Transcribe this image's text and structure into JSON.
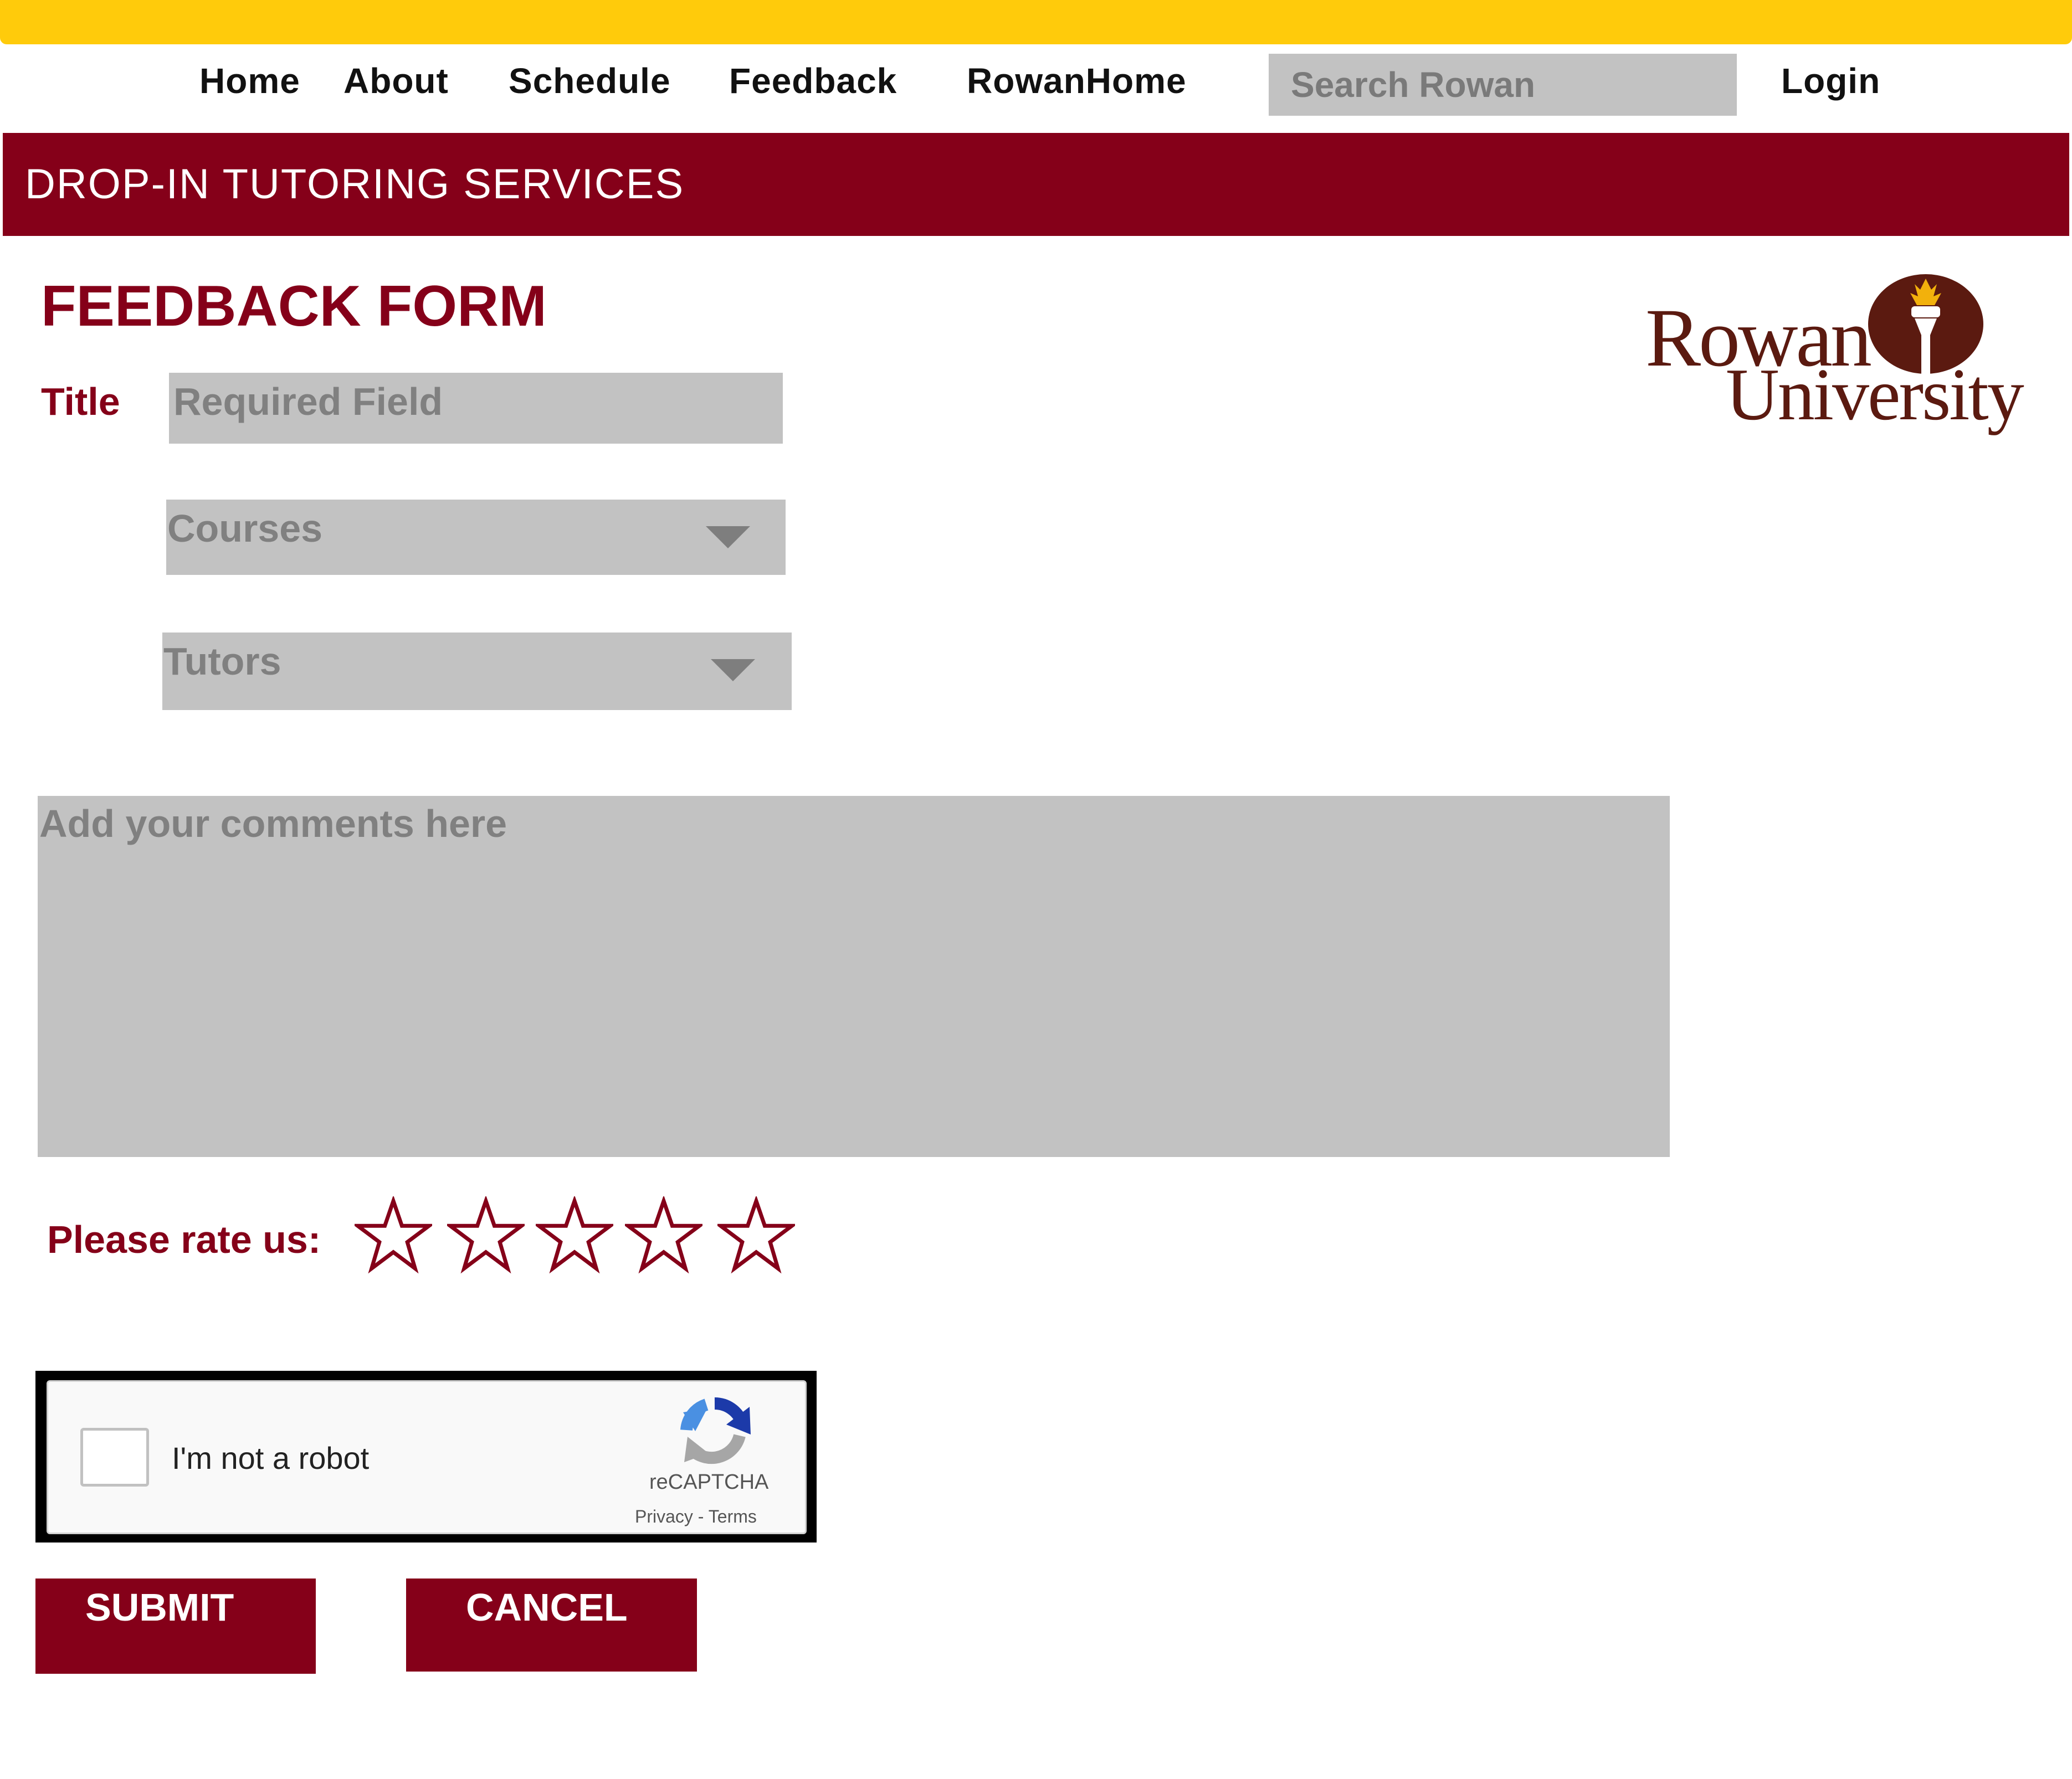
{
  "nav": {
    "home": "Home",
    "about": "About",
    "schedule": "Schedule",
    "feedback": "Feedback",
    "rowan_home": "RowanHome",
    "search_placeholder": "Search Rowan",
    "login": "Login"
  },
  "banner": {
    "title": "DROP-IN TUTORING SERVICES"
  },
  "logo": {
    "line1": "Rowan",
    "line2": "University"
  },
  "form": {
    "heading": "FEEDBACK FORM",
    "title_label": "Title",
    "title_placeholder": "Required Field",
    "courses_select": "Courses",
    "tutors_select": "Tutors",
    "comments_placeholder": "Add your comments here",
    "rating_label": "Please rate us:",
    "rating": {
      "value": 0,
      "max": 5
    }
  },
  "captcha": {
    "label": "I'm not a robot",
    "brand": "reCAPTCHA",
    "links": "Privacy - Terms"
  },
  "buttons": {
    "submit": "SUBMIT",
    "cancel": "CANCEL"
  },
  "colors": {
    "gold": "#ffcb0b",
    "maroon": "#850019",
    "field_gray": "#c2c2c2"
  },
  "icons": {
    "dropdown": "chevron-down-icon",
    "rating": "star-outline-icon",
    "captcha": "recaptcha-icon"
  }
}
